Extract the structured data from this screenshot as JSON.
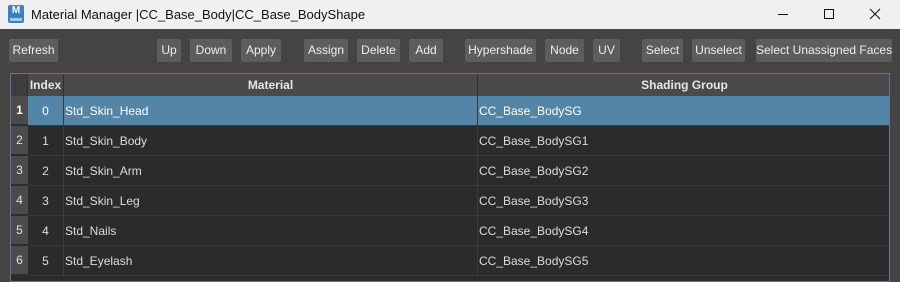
{
  "window": {
    "title": "Material Manager |CC_Base_Body|CC_Base_BodyShape",
    "app_icon_letter": "M",
    "controls": [
      "minimize-icon",
      "maximize-icon",
      "close-icon"
    ]
  },
  "toolbar": {
    "refresh": "Refresh",
    "up": "Up",
    "down": "Down",
    "apply": "Apply",
    "assign": "Assign",
    "delete": "Delete",
    "add": "Add",
    "hypershade": "Hypershade",
    "node": "Node",
    "uv": "UV",
    "select": "Select",
    "unselect": "Unselect",
    "select_unassigned": "Select Unassigned Faces"
  },
  "table": {
    "columns": {
      "index": "Index",
      "material": "Material",
      "shading_group": "Shading Group"
    },
    "selected_row": 0,
    "rows": [
      {
        "num": "1",
        "index": "0",
        "material": "Std_Skin_Head",
        "shading_group": "CC_Base_BodySG"
      },
      {
        "num": "2",
        "index": "1",
        "material": "Std_Skin_Body",
        "shading_group": "CC_Base_BodySG1"
      },
      {
        "num": "3",
        "index": "2",
        "material": "Std_Skin_Arm",
        "shading_group": "CC_Base_BodySG2"
      },
      {
        "num": "4",
        "index": "3",
        "material": "Std_Skin_Leg",
        "shading_group": "CC_Base_BodySG3"
      },
      {
        "num": "5",
        "index": "4",
        "material": "Std_Nails",
        "shading_group": "CC_Base_BodySG4"
      },
      {
        "num": "6",
        "index": "5",
        "material": "Std_Eyelash",
        "shading_group": "CC_Base_BodySG5"
      }
    ]
  },
  "colors": {
    "background": "#444444",
    "button": "#5d5d5d",
    "selection": "#5285a6",
    "table_bg": "#2b2b2b"
  }
}
